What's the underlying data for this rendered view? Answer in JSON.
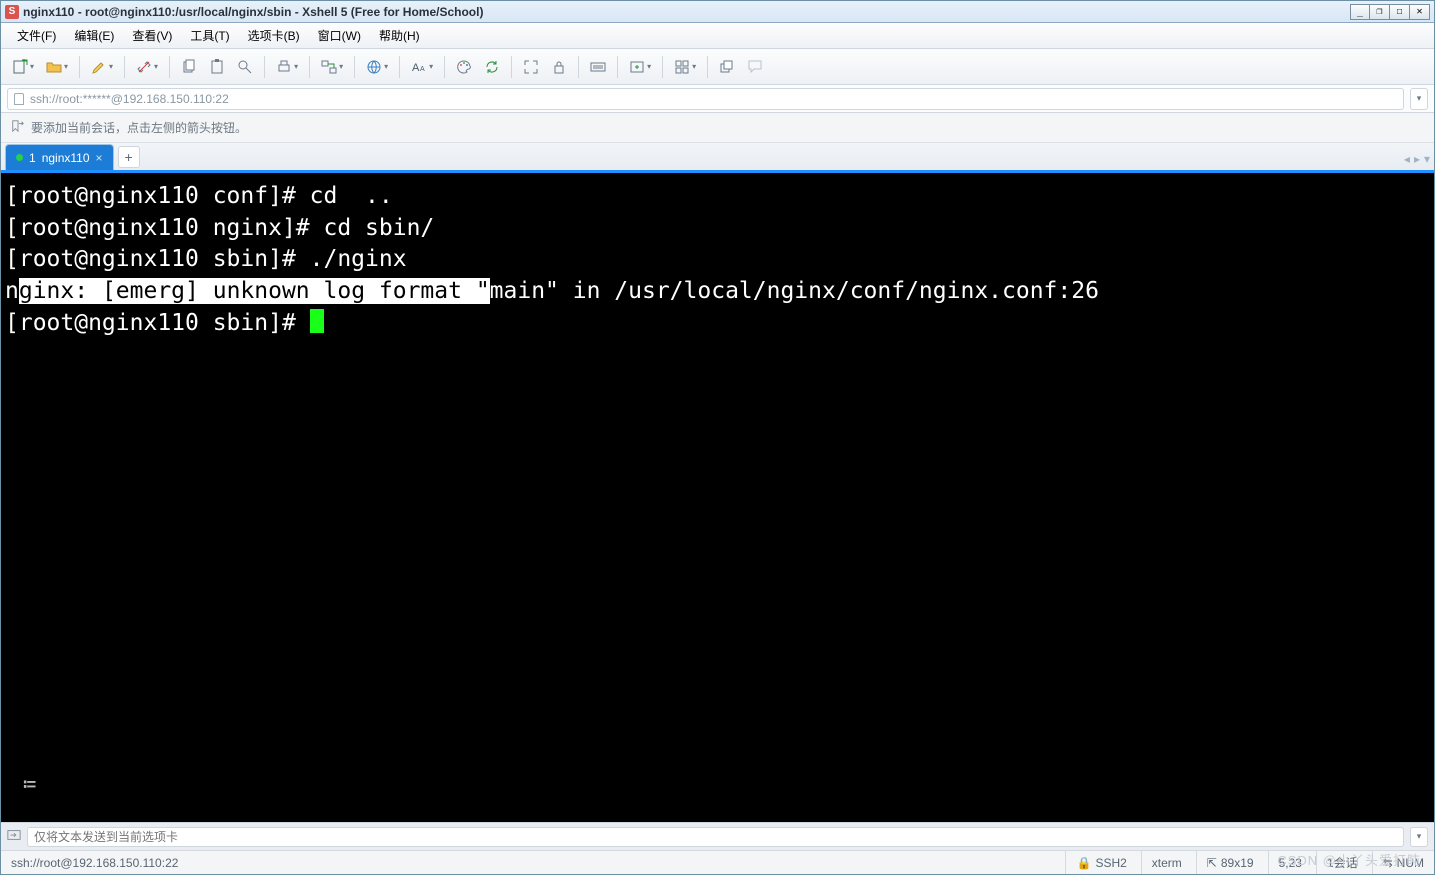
{
  "window": {
    "title": "nginx110 - root@nginx110:/usr/local/nginx/sbin - Xshell 5 (Free for Home/School)",
    "min_glyph": "_",
    "restore_glyph": "❐",
    "max_glyph": "☐",
    "close_glyph": "✕"
  },
  "menu": {
    "file": "文件(F)",
    "edit": "编辑(E)",
    "view": "查看(V)",
    "tools": "工具(T)",
    "tabs": "选项卡(B)",
    "window": "窗口(W)",
    "help": "帮助(H)"
  },
  "toolbar_icons": {
    "new_session": "new-session-icon",
    "open": "folder-open-icon",
    "paint": "highlight-icon",
    "disconnect": "disconnect-icon",
    "copy": "copy-icon",
    "paste": "paste-icon",
    "find": "find-icon",
    "print": "print-icon",
    "transfer": "transfer-icon",
    "globe": "globe-icon",
    "font": "font-size-icon",
    "palette": "palette-icon",
    "refresh": "refresh-icon",
    "fullscreen": "fullscreen-icon",
    "lock": "lock-icon",
    "keyboard": "keyboard-icon",
    "addtab": "add-tab-icon",
    "layout": "layout-icon",
    "cascade": "cascade-icon",
    "help": "help-tip-icon"
  },
  "address": {
    "url": "ssh://root:******@192.168.150.110:22"
  },
  "hint": {
    "text": "要添加当前会话，点击左侧的箭头按钮。"
  },
  "tabs": {
    "items": [
      {
        "index": "1",
        "label": "nginx110"
      }
    ],
    "add": "+"
  },
  "terminal": {
    "lines": [
      {
        "seg": [
          {
            "t": "[root@nginx110 conf]# cd  .."
          }
        ]
      },
      {
        "seg": [
          {
            "t": "[root@nginx110 nginx]# cd sbin/"
          }
        ]
      },
      {
        "seg": [
          {
            "t": "[root@nginx110 sbin]# ./nginx"
          }
        ]
      },
      {
        "seg": [
          {
            "t": "n"
          },
          {
            "t": "ginx: [emerg] unknown log format \"",
            "sel": true
          },
          {
            "t": "main\" in /usr/local/nginx/conf/nginx.conf:26"
          }
        ]
      },
      {
        "seg": [
          {
            "t": "[root@nginx110 sbin]# "
          }
        ],
        "cursor": true
      }
    ]
  },
  "cmdbar": {
    "placeholder": "仅将文本发送到当前选项卡"
  },
  "status": {
    "conn": "ssh://root@192.168.150.110:22",
    "proto_icon": "🔒",
    "proto": "SSH2",
    "term": "xterm",
    "size_icon": "⇱",
    "size": "89x19",
    "pos": "5,23",
    "sessions": "1会话",
    "caps_icon": "⇆",
    "caps": "NUM"
  },
  "watermark": "CSDN @小丫头爱打盹"
}
